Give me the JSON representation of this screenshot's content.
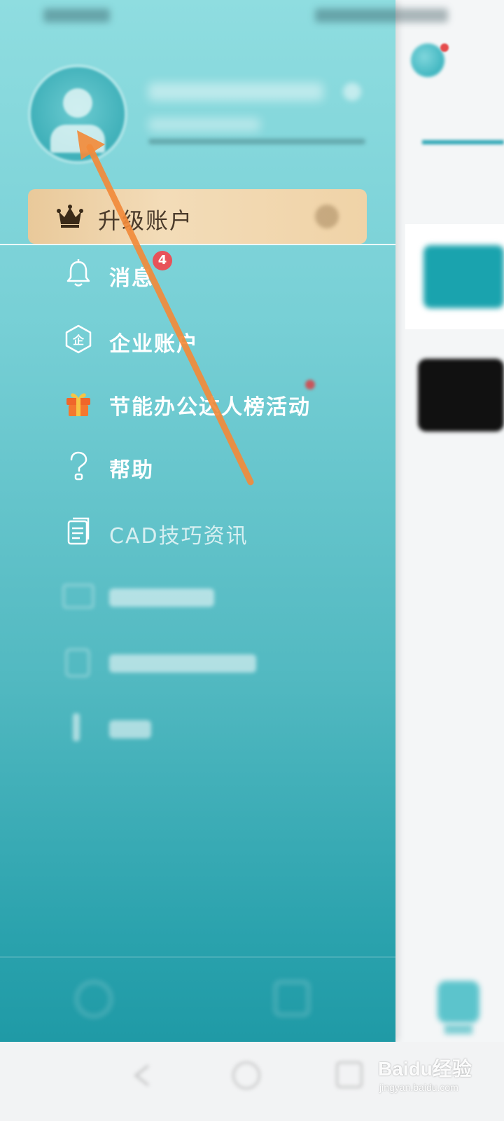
{
  "drawer": {
    "upgrade_label": "升级账户",
    "menu": [
      {
        "label": "消息",
        "icon": "bell-icon",
        "badge": "4"
      },
      {
        "label": "企业账户",
        "icon": "enterprise-icon"
      },
      {
        "label": "节能办公达人榜活动",
        "icon": "gift-icon"
      },
      {
        "label": "帮助",
        "icon": "help-icon"
      },
      {
        "label": "CAD技巧资讯",
        "icon": "document-icon"
      }
    ]
  },
  "annotation": {
    "color": "#f28b3b",
    "target": "avatar"
  },
  "colors": {
    "drawer_top": "#8fdde0",
    "drawer_bottom": "#1f9aa6",
    "upgrade_gold": "#e9c99a",
    "badge_red": "#e8525a",
    "accent": "#2aa5b3"
  },
  "watermark": {
    "text": "Baidu经验",
    "sub": "jingyan.baidu.com"
  }
}
